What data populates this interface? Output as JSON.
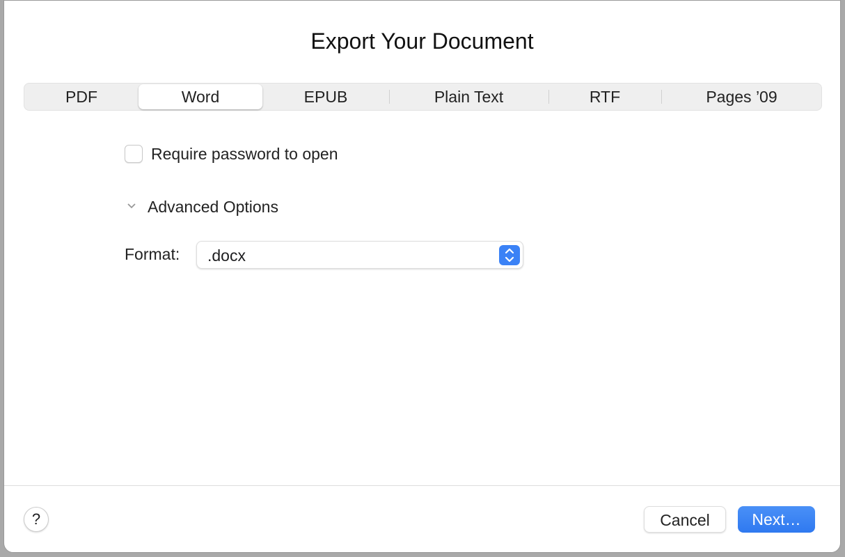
{
  "dialog": {
    "title": "Export Your Document"
  },
  "tabs": [
    {
      "label": "PDF"
    },
    {
      "label": "Word",
      "selected": true
    },
    {
      "label": "EPUB"
    },
    {
      "label": "Plain Text"
    },
    {
      "label": "RTF"
    },
    {
      "label": "Pages ’09"
    }
  ],
  "options": {
    "require_password": {
      "label": "Require password to open",
      "checked": false
    },
    "advanced": {
      "label": "Advanced Options",
      "expanded": true
    },
    "format": {
      "label": "Format:",
      "value": ".docx"
    }
  },
  "footer": {
    "help": "?",
    "cancel": "Cancel",
    "next": "Next…"
  },
  "colors": {
    "accent": "#3b82f6"
  }
}
